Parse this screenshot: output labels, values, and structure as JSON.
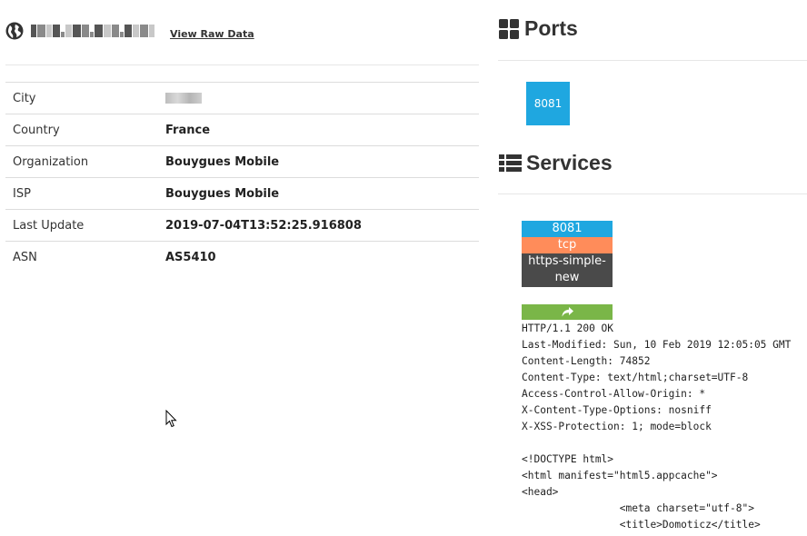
{
  "host": {
    "view_raw_label": "View Raw Data"
  },
  "info_rows": [
    {
      "key": "City",
      "value": ""
    },
    {
      "key": "Country",
      "value": "France"
    },
    {
      "key": "Organization",
      "value": "Bouygues Mobile"
    },
    {
      "key": "ISP",
      "value": "Bouygues Mobile"
    },
    {
      "key": "Last Update",
      "value": "2019-07-04T13:52:25.916808"
    },
    {
      "key": "ASN",
      "value": "AS5410"
    }
  ],
  "ports": {
    "title": "Ports",
    "items": [
      "8081"
    ]
  },
  "services": {
    "title": "Services",
    "port": "8081",
    "transport": "tcp",
    "name": "https-simple-new",
    "banner": [
      "HTTP/1.1 200 OK",
      "Last-Modified: Sun, 10 Feb 2019 12:05:05 GMT",
      "Content-Length: 74852",
      "Content-Type: text/html;charset=UTF-8",
      "Access-Control-Allow-Origin: *",
      "X-Content-Type-Options: nosniff",
      "X-XSS-Protection: 1; mode=block",
      "",
      "<!DOCTYPE html>",
      "<html manifest=\"html5.appcache\">",
      "<head>",
      "                <meta charset=\"utf-8\">",
      "                <title>Domoticz</title>"
    ]
  },
  "colors": {
    "port_blue": "#1fa7e0",
    "transport_orange": "#ff8c5a",
    "service_dark": "#4a4a4a",
    "share_green": "#7ab648"
  }
}
